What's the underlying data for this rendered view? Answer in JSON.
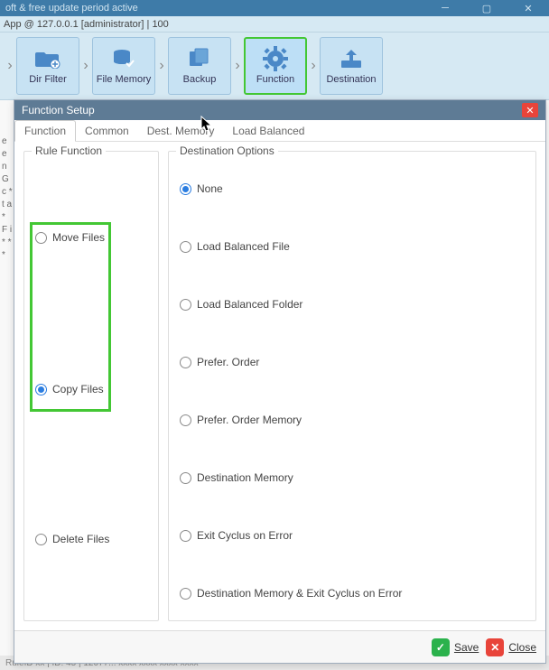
{
  "titlebar": {
    "text": "oft & free update period active"
  },
  "status": {
    "text": "App @ 127.0.0.1 [administrator]   |   100"
  },
  "toolbar": {
    "items": [
      {
        "label": "Dir Filter"
      },
      {
        "label": "File Memory"
      },
      {
        "label": "Backup"
      },
      {
        "label": "Function"
      },
      {
        "label": "Destination"
      }
    ]
  },
  "dialog": {
    "title": "Function Setup",
    "tabs": {
      "t0": "Function",
      "t1": "Common",
      "t2": "Dest. Memory",
      "t3": "Load Balanced"
    },
    "ruleFunction": {
      "title": "Rule Function",
      "move": "Move Files",
      "copy": "Copy Files",
      "delete": "Delete Files"
    },
    "destOptions": {
      "title": "Destination Options",
      "none": "None",
      "lbFile": "Load Balanced File",
      "lbFolder": "Load Balanced Folder",
      "preferOrder": "Prefer. Order",
      "preferOrderMem": "Prefer. Order Memory",
      "destMem": "Destination Memory",
      "exitErr": "Exit Cyclus on Error",
      "destMemExitErr": "Destination Memory & Exit Cyclus on Error"
    },
    "footer": {
      "save": "Save",
      "close": "Close"
    }
  },
  "bottomStatus": "RuleID xx | ID: 45 | 12077... xxxx xxxx xxxx xxxx"
}
